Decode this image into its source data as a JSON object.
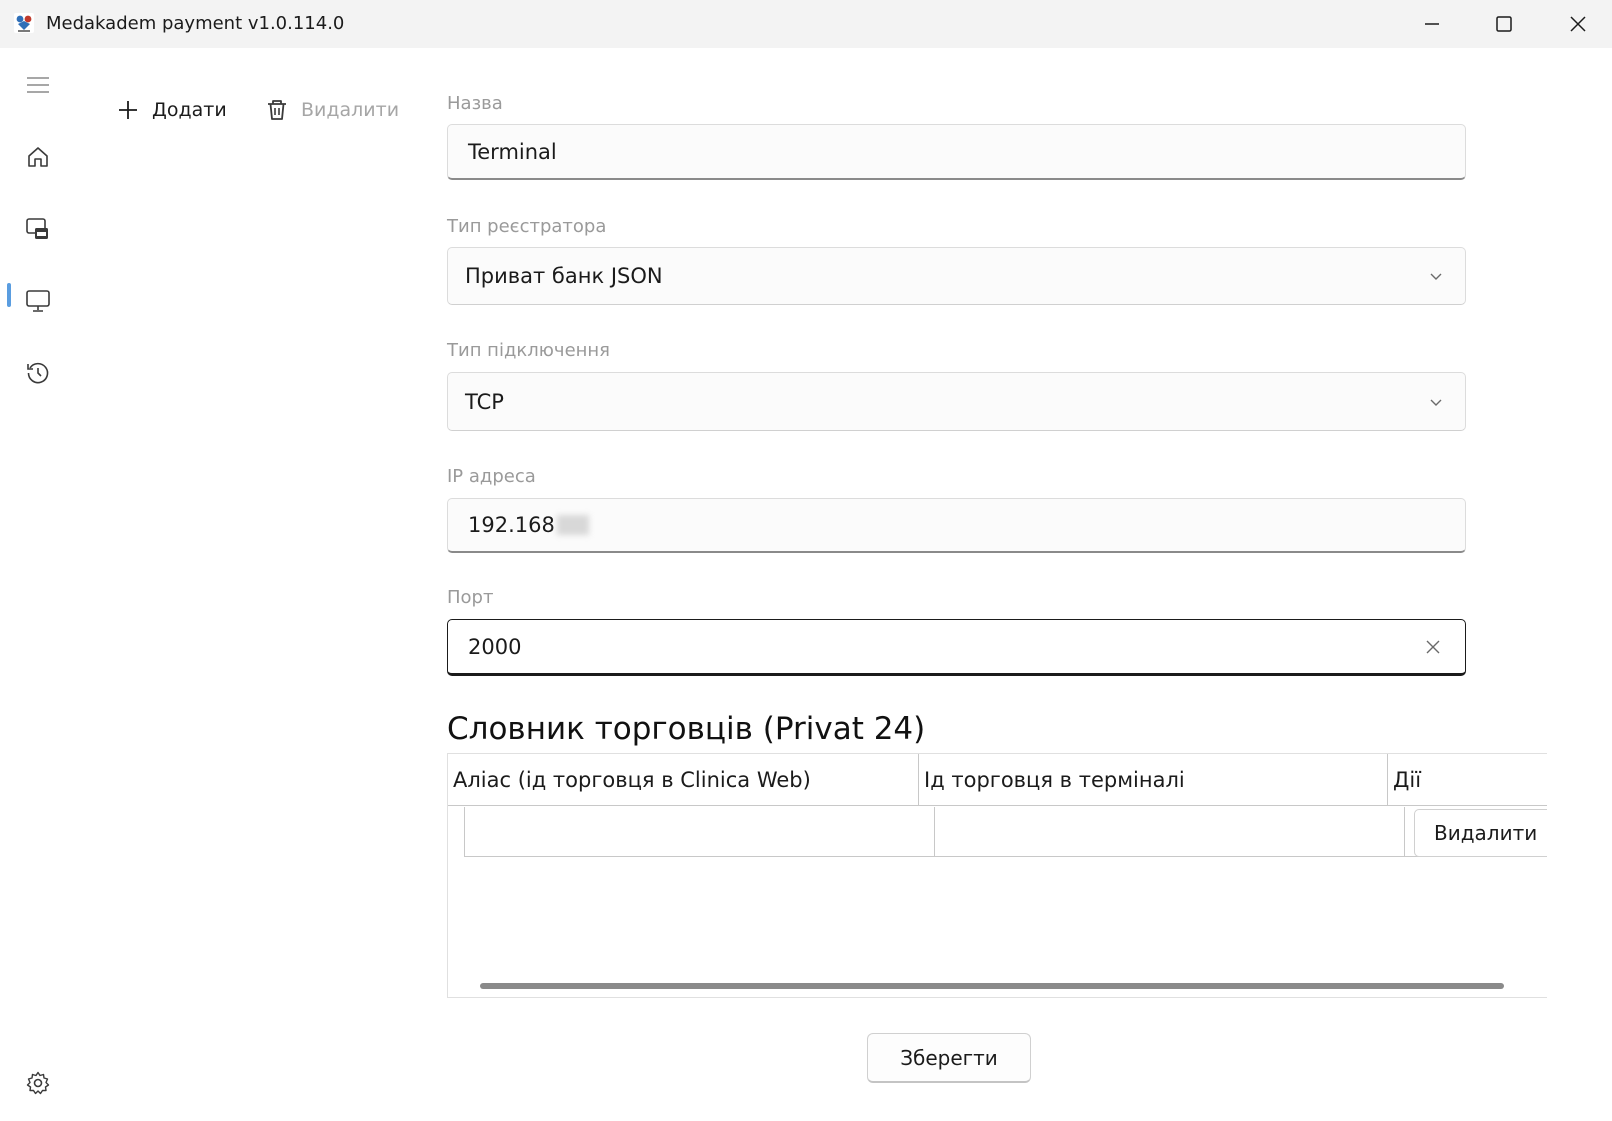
{
  "window": {
    "title": "Medakadem payment v1.0.114.0",
    "icon": "app-logo-icon",
    "controls": [
      "minimize-icon",
      "maximize-icon",
      "close-icon"
    ]
  },
  "nav": {
    "items": [
      {
        "icon": "hamburger-menu-icon"
      },
      {
        "icon": "home-icon"
      },
      {
        "icon": "payment-terminal-icon"
      },
      {
        "icon": "monitor-icon",
        "selected": true
      },
      {
        "icon": "history-icon"
      }
    ],
    "footer_icon": "settings-icon",
    "accent": "#5a9de0"
  },
  "commands": {
    "add_label": "Додати",
    "delete_label": "Видалити"
  },
  "form": {
    "name": {
      "label": "Назва",
      "value": "Terminal"
    },
    "registrar_type": {
      "label": "Тип реєстратора",
      "value": "Приват банк JSON"
    },
    "connection_type": {
      "label": "Тип підключення",
      "value": "TCP"
    },
    "ip": {
      "label": "IP адреса",
      "value": "192.168"
    },
    "port": {
      "label": "Порт",
      "value": "2000"
    }
  },
  "merchants": {
    "title": "Словник торговців (Privat 24)",
    "columns": [
      "Аліас (ід торговця в Clinica Web)",
      "Ід торговця в терміналі",
      "Дії"
    ],
    "rows": [
      {
        "alias": "",
        "terminal_id": "",
        "action_label": "Видалити"
      }
    ]
  },
  "save_label": "Зберегти"
}
